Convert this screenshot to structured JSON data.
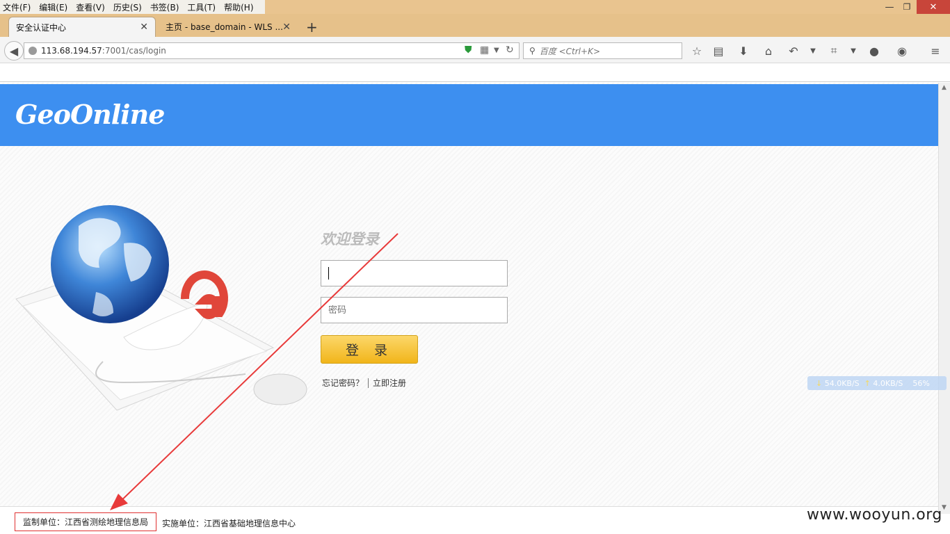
{
  "menu": [
    "文件(F)",
    "编辑(E)",
    "查看(V)",
    "历史(S)",
    "书签(B)",
    "工具(T)",
    "帮助(H)"
  ],
  "tabs": [
    {
      "label": "安全认证中心",
      "close": "✕"
    },
    {
      "label": "主页 - base_domain - WLS ...",
      "close": "✕"
    }
  ],
  "new_tab": "+",
  "url": {
    "host": "113.68.194.57",
    "path": ":7001/cas/login"
  },
  "search": {
    "placeholder": "百度 <Ctrl+K>"
  },
  "toolbar_icons": [
    "star-icon",
    "reading-list-icon",
    "download-icon",
    "home-icon",
    "undo-icon",
    "crop-icon",
    "chat-icon",
    "profile-icon",
    "menu-icon"
  ],
  "site": {
    "logo": "GeoOnline",
    "welcome": "欢迎登录",
    "username_value": "",
    "password_placeholder": "密码",
    "login_button": "登 录",
    "forgot": "忘记密码？",
    "register": "立即注册"
  },
  "netmon": {
    "down": "54.0KB/S",
    "up": "4.0KB/S",
    "pct": "56%"
  },
  "footer": {
    "supervisor": "监制单位：江西省测绘地理信息局",
    "implementer": "实施单位：江西省基础地理信息中心"
  },
  "watermark": "www.wooyun.org",
  "colors": {
    "header": "#3d8ff0",
    "button": "#f4bd25",
    "annotation": "#e03030"
  }
}
